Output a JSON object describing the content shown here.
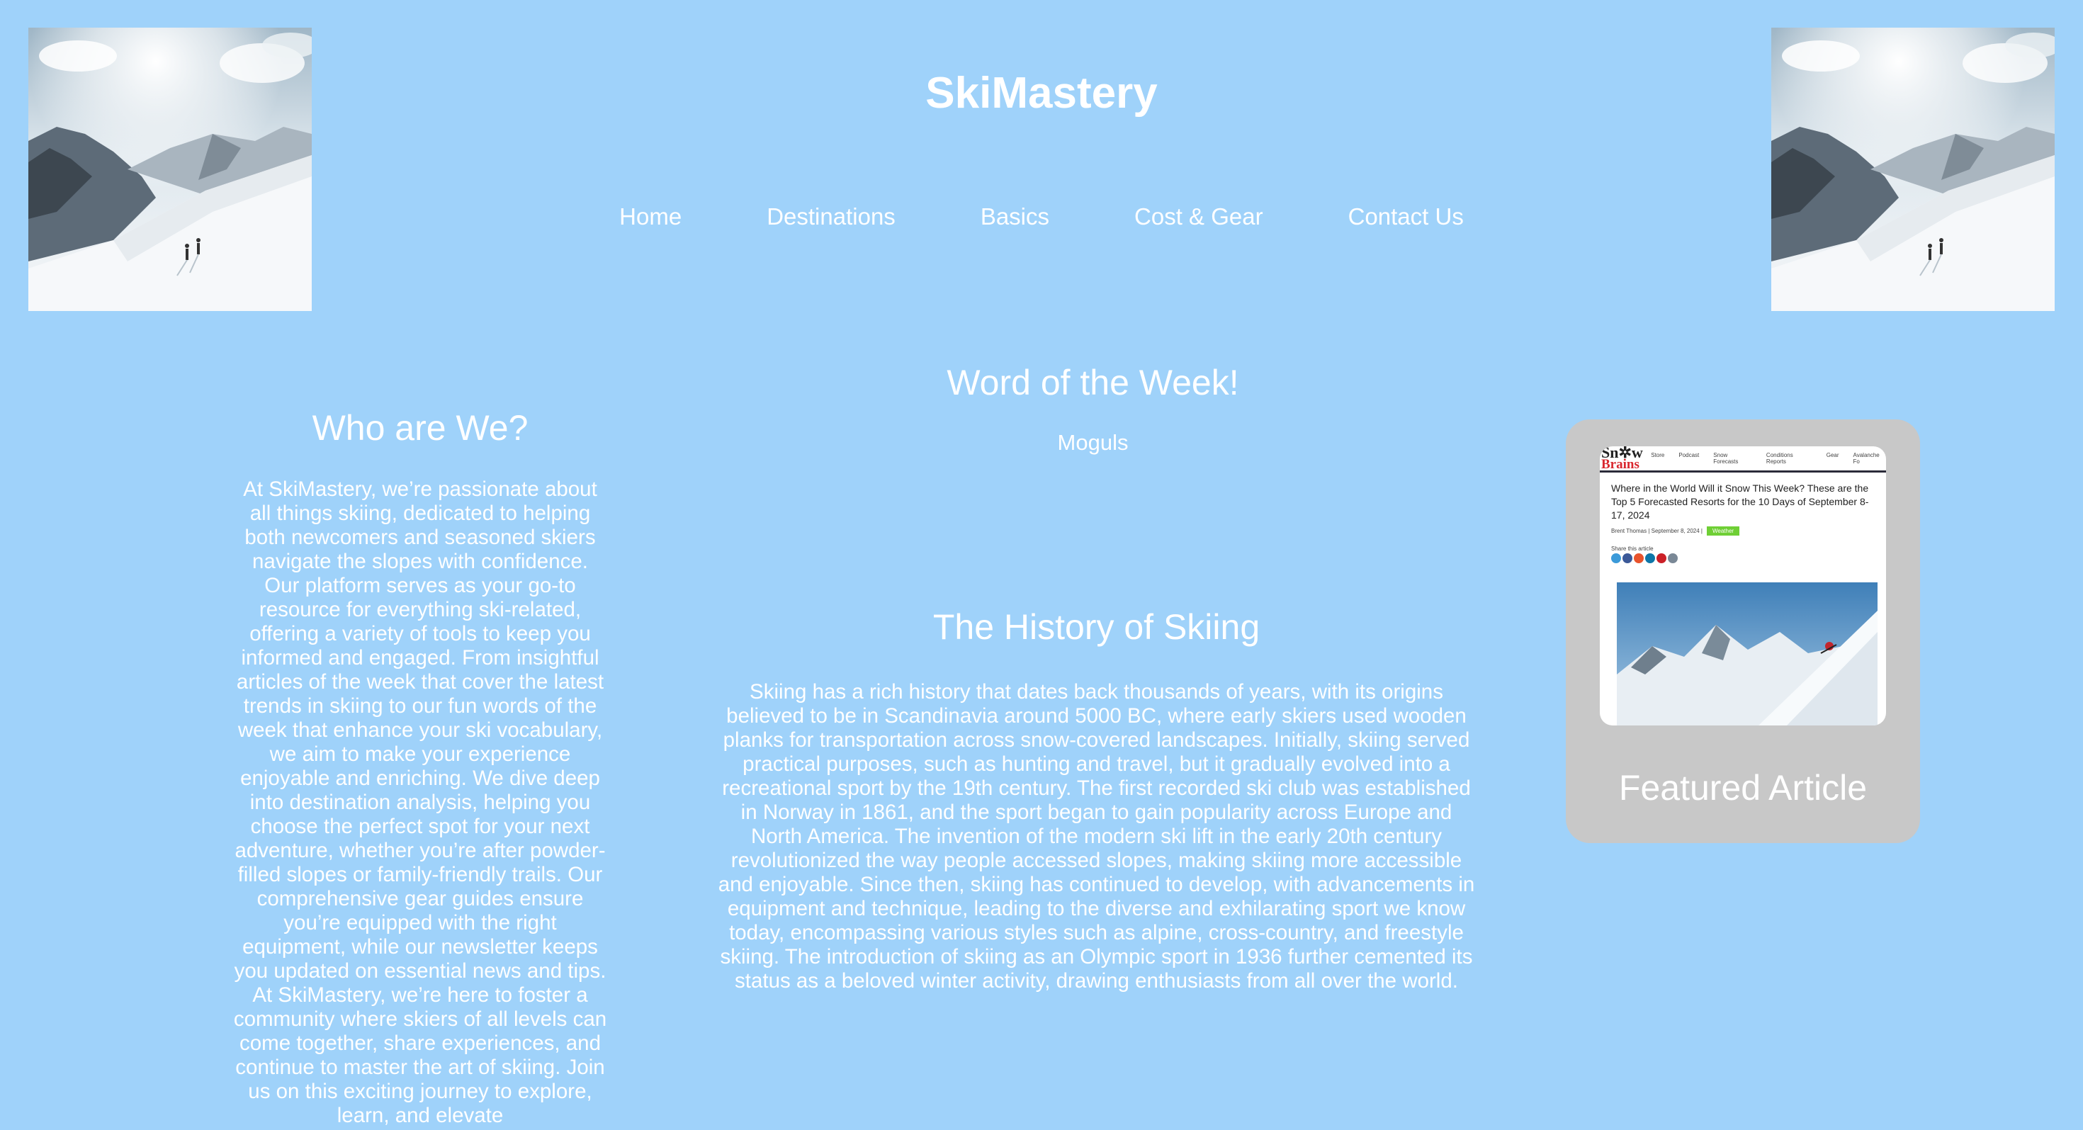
{
  "header": {
    "title": "SkiMastery",
    "nav": [
      {
        "label": "Home"
      },
      {
        "label": "Destinations"
      },
      {
        "label": "Basics"
      },
      {
        "label": "Cost & Gear"
      },
      {
        "label": "Contact Us"
      }
    ]
  },
  "images": {
    "left_banner": "mountain-skiers-photo",
    "right_banner": "mountain-skiers-photo"
  },
  "about": {
    "heading": "Who are We?",
    "body": "At SkiMastery, we’re passionate about all things skiing, dedicated to helping both newcomers and seasoned skiers navigate the slopes with confidence. Our platform serves as your go-to resource for everything ski-related, offering a variety of tools to keep you informed and engaged. From insightful articles of the week that cover the latest trends in skiing to our fun words of the week that enhance your ski vocabulary, we aim to make your experience enjoyable and enriching. We dive deep into destination analysis, helping you choose the perfect spot for your next adventure, whether you’re after powder-filled slopes or family-friendly trails. Our comprehensive gear guides ensure you’re equipped with the right equipment, while our newsletter keeps you updated on essential news and tips. At SkiMastery, we’re here to foster a community where skiers of all levels can come together, share experiences, and continue to master the art of skiing. Join us on this exciting journey to explore, learn, and elevate"
  },
  "word_of_week": {
    "heading": "Word of the Week!",
    "word": "Moguls"
  },
  "history": {
    "heading": "The History of Skiing",
    "body": "Skiing has a rich history that dates back thousands of years, with its origins believed to be in Scandinavia around 5000 BC, where early skiers used wooden planks for transportation across snow-covered landscapes. Initially, skiing served practical purposes, such as hunting and travel, but it gradually evolved into a recreational sport by the 19th century. The first recorded ski club was established in Norway in 1861, and the sport began to gain popularity across Europe and North America. The invention of the modern ski lift in the early 20th century revolutionized the way people accessed slopes, making skiing more accessible and enjoyable. Since then, skiing has continued to develop, with advancements in equipment and technique, leading to the diverse and exhilarating sport we know today, encompassing various styles such as alpine, cross-country, and freestyle skiing. The introduction of skiing as an Olympic sport in 1936 further cemented its status as a beloved winter activity, drawing enthusiasts from all over the world."
  },
  "featured": {
    "caption": "Featured Article",
    "thumbnail": {
      "logo_top": "Sn✲w",
      "logo_bottom": "Brains",
      "nav": [
        "Store",
        "Podcast",
        "Snow Forecasts",
        "Conditions Reports",
        "Gear",
        "Avalanche Fo"
      ],
      "headline": "Where in the World Will it Snow This Week? These are the Top 5 Forecasted Resorts for the 10 Days of September 8-17, 2024",
      "meta": "Brent Thomas | September 8, 2024 |",
      "tag": "Weather",
      "share_label": "Share this article"
    }
  },
  "colors": {
    "background": "#9fd2fa",
    "text": "#ffffff",
    "card": "#c8c8c8"
  }
}
